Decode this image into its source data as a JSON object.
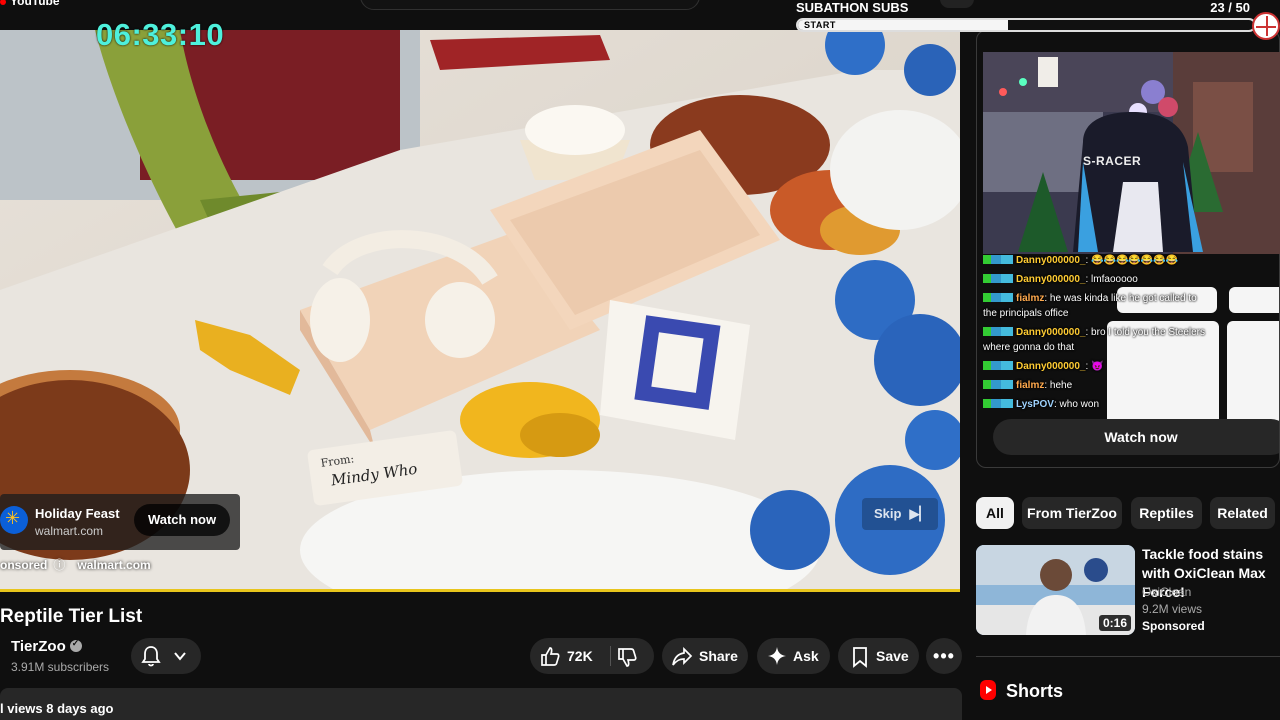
{
  "browser": {
    "logo_text": "YouTube"
  },
  "overlay": {
    "timer": "06:33:10",
    "subathon_title": "SUBATHON SUBS",
    "subathon_count": "23  / 50",
    "subathon_progress": 0.46,
    "subathon_start_label": "START"
  },
  "video": {
    "note_from": "From:",
    "note_name": "Mindy Who",
    "ad": {
      "title": "Holiday Feast",
      "url": "walmart.com",
      "watch_label": "Watch now",
      "sponsored_label": "onsored",
      "sponsored_domain": "walmart.com",
      "skip_label": "Skip"
    },
    "progress_color": "#e8c51c"
  },
  "meta": {
    "title": "Reptile Tier List",
    "channel_name": "TierZoo",
    "subscribers": "3.91M subscribers",
    "like_count": "72K",
    "share_label": "Share",
    "ask_label": "Ask",
    "save_label": "Save",
    "more_label": "•••",
    "stats": "l views  8 days ago"
  },
  "sidebar": {
    "ad_watch_label": "Watch now",
    "cam": {
      "chair_brand": "S-RACER"
    },
    "chat": [
      {
        "user": "Danny000000_",
        "message": ": 😂😂😂😂😂😂😂"
      },
      {
        "user": "Danny000000_",
        "message": ": lmfaooooo"
      },
      {
        "user": "fialmz",
        "message": ": he was kinda like he got called to"
      },
      {
        "user": "",
        "message": "the principals office"
      },
      {
        "user": "Danny000000_",
        "message": ": bro I told you the Steelers"
      },
      {
        "user": "",
        "message": "where gonna do that"
      },
      {
        "user": "Danny000000_",
        "message": ": 😈"
      },
      {
        "user": "fialmz",
        "message": ": hehe"
      },
      {
        "user": "LysPOV",
        "message": ": who won"
      }
    ],
    "chips": [
      "All",
      "From TierZoo",
      "Reptiles",
      "Related"
    ],
    "recommendation": {
      "title": "Tackle food stains with OxiClean Max Force!",
      "channel": "OxiClean",
      "views": "9.2M views",
      "badge": "Sponsored",
      "duration": "0:16"
    },
    "shorts_label": "Shorts"
  }
}
